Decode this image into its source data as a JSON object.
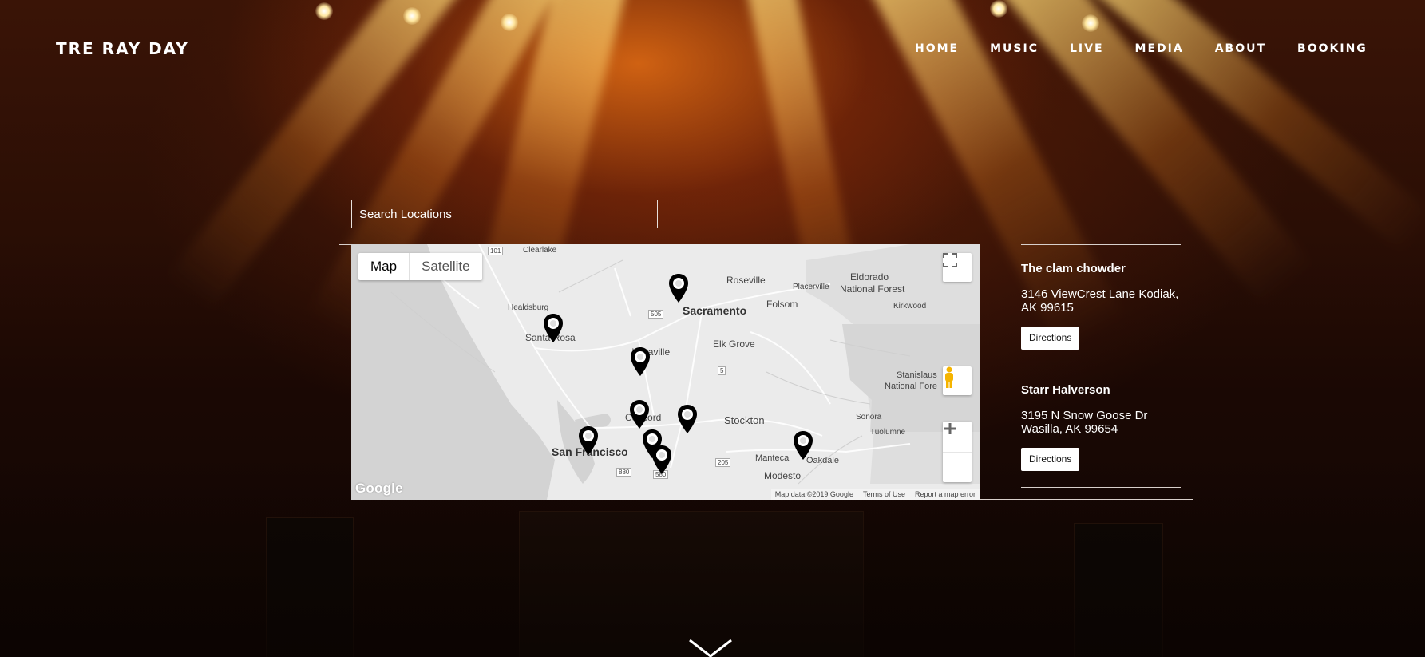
{
  "site": {
    "brand": "TRE RAY DAY"
  },
  "nav": {
    "items": [
      {
        "label": "HOME"
      },
      {
        "label": "MUSIC"
      },
      {
        "label": "LIVE"
      },
      {
        "label": "MEDIA"
      },
      {
        "label": "ABOUT"
      },
      {
        "label": "BOOKING"
      }
    ]
  },
  "search": {
    "placeholder": "Search Locations",
    "value": ""
  },
  "map": {
    "type_buttons": {
      "map": "Map",
      "satellite": "Satellite"
    },
    "logo": "Google",
    "attribution": {
      "data": "Map data ©2019 Google",
      "terms": "Terms of Use",
      "report": "Report a map error"
    },
    "labels": {
      "clearlake": "Clearlake",
      "roseville": "Roseville",
      "eldorado": "Eldorado",
      "national_forest": "National Forest",
      "placerville": "Placerville",
      "kirkwood": "Kirkwood",
      "folsom": "Folsom",
      "healdsburg": "Healdsburg",
      "sacramento": "Sacramento",
      "santa_rosa": "Santa Rosa",
      "vacaville": "Vacaville",
      "elk_grove": "Elk Grove",
      "stanislaus": "Stanislaus",
      "stanislaus_nf": "National Fore",
      "concord": "Concord",
      "stockton": "Stockton",
      "sonora": "Sonora",
      "tuolumne": "Tuolumne",
      "san_francisco": "San Francisco",
      "manteca": "Manteca",
      "oakdale": "Oakdale",
      "modesto": "Modesto",
      "hwy_101": "101",
      "hwy_505": "505",
      "hwy_5": "5",
      "hwy_880": "880",
      "hwy_205": "205",
      "hwy_580": "580"
    },
    "accent_pin": "#000000"
  },
  "locations": [
    {
      "name": "The clam chowder",
      "address": "3146 ViewCrest Lane Kodiak, AK 99615",
      "directions": "Directions"
    },
    {
      "name": "Starr Halverson",
      "address": "3195 N Snow Goose Dr Wasilla, AK 99654",
      "directions": "Directions"
    }
  ]
}
